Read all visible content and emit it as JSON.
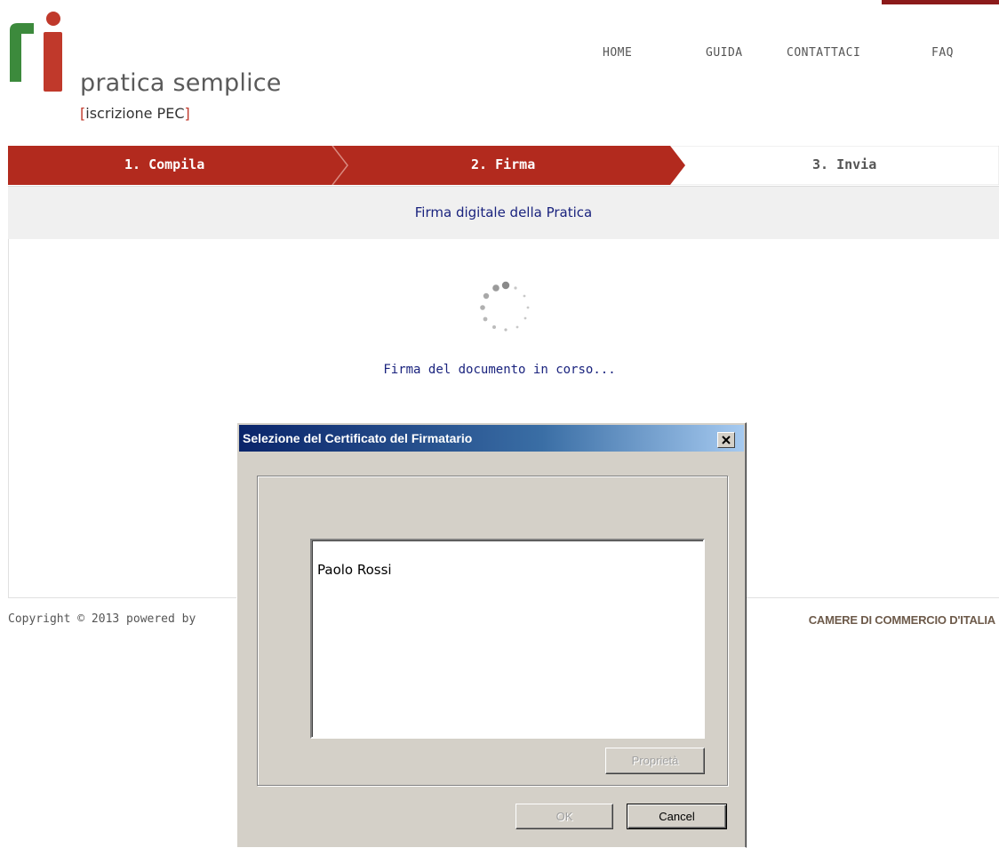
{
  "logo": {
    "title": "pratica semplice",
    "sub_open": "[",
    "sub_text": "iscrizione PEC",
    "sub_close": "]"
  },
  "nav": {
    "home": "HOME",
    "guida": "GUIDA",
    "contattaci": "CONTATTACI",
    "faq": "FAQ"
  },
  "steps": [
    {
      "label": "1. Compila",
      "state": "done"
    },
    {
      "label": "2. Firma",
      "state": "active"
    },
    {
      "label": "3. Invia",
      "state": "pending"
    }
  ],
  "panel": {
    "title": "Firma digitale della Pratica",
    "progress_text": "Firma del documento in corso..."
  },
  "footer": {
    "copyright": "Copyright © 2013 powered by",
    "right": "CAMERE DI COMMERCIO D'ITALIA"
  },
  "dialog": {
    "title": "Selezione del Certificato  del Firmatario",
    "close_label": "x",
    "certificates": [
      "Paolo Rossi"
    ],
    "properties_label": "Proprietà",
    "ok_label": "OK",
    "cancel_label": "Cancel"
  },
  "colors": {
    "brand_red": "#b22a1e",
    "brand_green": "#3c8a3c",
    "link_blue": "#1a237e"
  }
}
